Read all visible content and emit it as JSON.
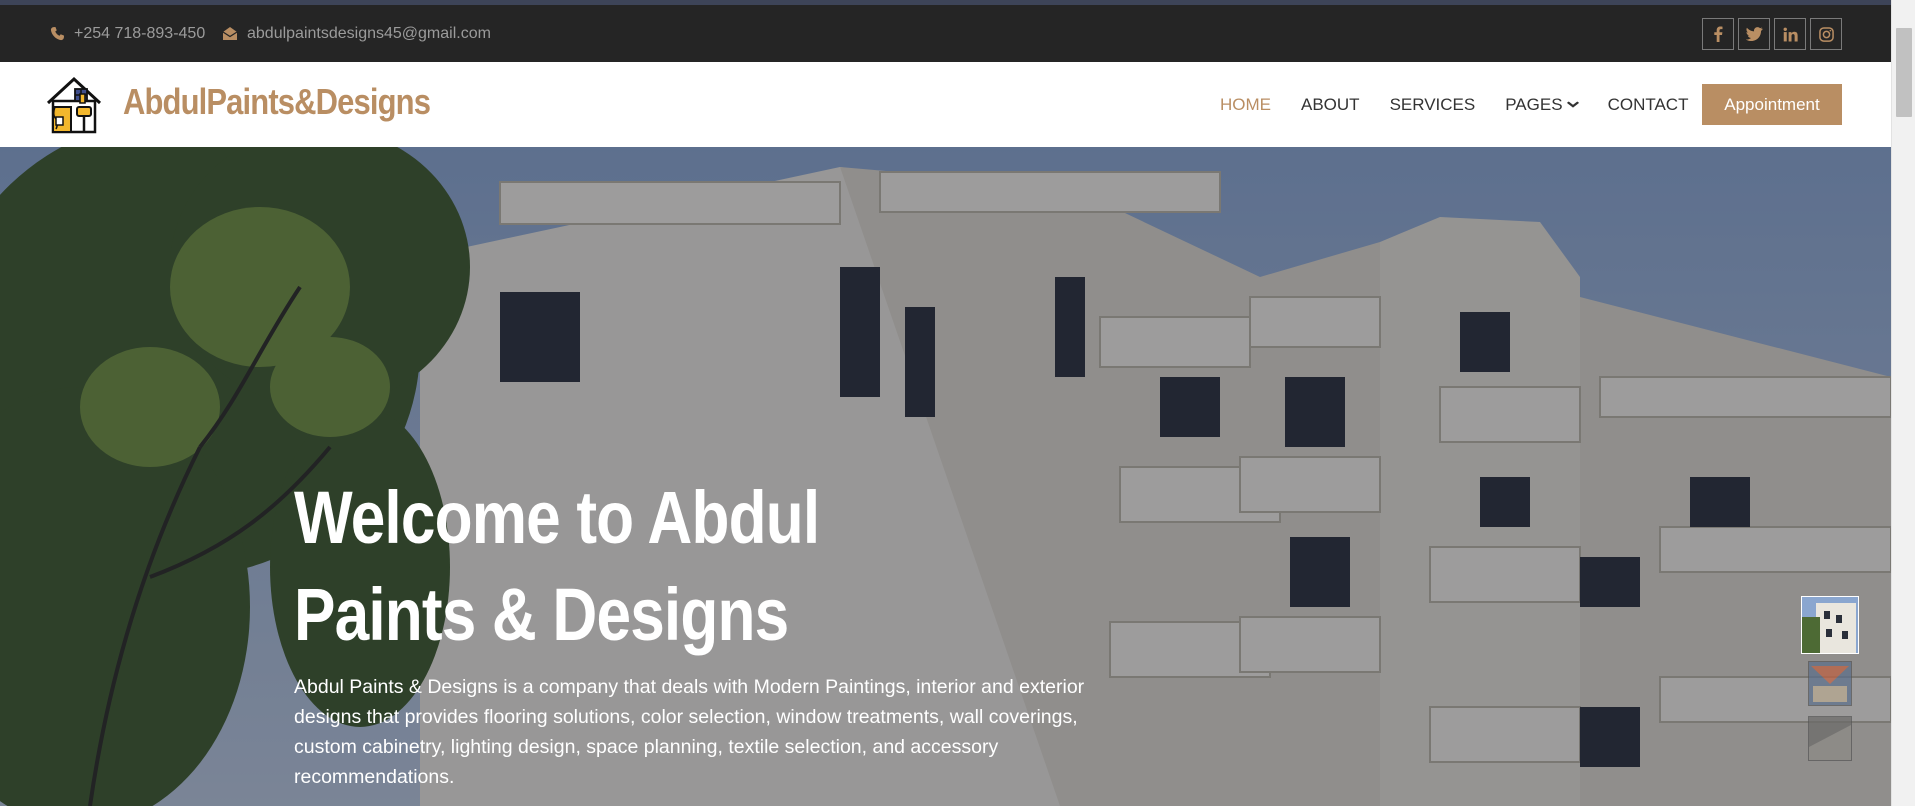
{
  "topbar": {
    "phone": "+254 718-893-450",
    "email": "abdulpaintsdesigns45@gmail.com",
    "socials": [
      {
        "name": "facebook",
        "glyph": "f"
      },
      {
        "name": "twitter",
        "glyph": "t"
      },
      {
        "name": "linkedin",
        "glyph": "in"
      },
      {
        "name": "instagram",
        "glyph": "ig"
      }
    ]
  },
  "header": {
    "brand": "AbdulPaints&Designs",
    "nav": {
      "home": "HOME",
      "about": "ABOUT",
      "services": "SERVICES",
      "pages": "PAGES",
      "contact": "CONTACT"
    },
    "appointment": "Appointment"
  },
  "hero": {
    "title": "Welcome to Abdul Paints & Designs",
    "description": "Abdul Paints & Designs is a company that deals with Modern Paintings, interior and exterior designs that provides flooring solutions, color selection, window treatments, wall coverings, custom cabinetry, lighting design, space planning, textile selection, and accessory recommendations."
  },
  "colors": {
    "accent": "#b98e63",
    "topbar_bg": "#252525",
    "nav_text": "#333333"
  },
  "icons": [
    "phone-icon",
    "envelope-icon",
    "chevron-down-icon",
    "facebook-icon",
    "twitter-icon",
    "linkedin-icon",
    "instagram-icon"
  ]
}
